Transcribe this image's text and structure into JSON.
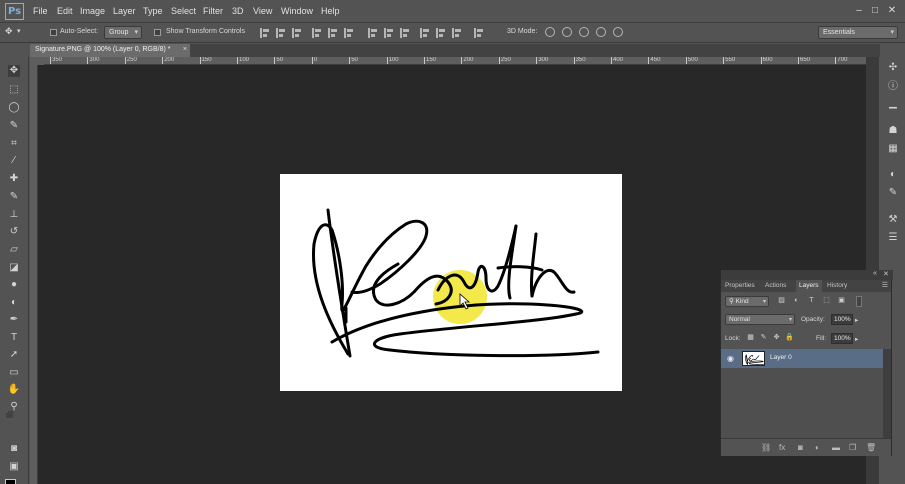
{
  "app": {
    "logo": "Ps",
    "menus": [
      "File",
      "Edit",
      "Image",
      "Layer",
      "Type",
      "Select",
      "Filter",
      "3D",
      "View",
      "Window",
      "Help"
    ],
    "window_controls": [
      "minimize-icon",
      "maximize-icon",
      "close-icon"
    ]
  },
  "options_bar": {
    "auto_select_label": "Auto-Select:",
    "auto_select_mode": "Group",
    "show_transform_label": "Show Transform Controls",
    "mode_3d_label": "3D Mode:",
    "workspace": "Essentials"
  },
  "document": {
    "tab_title": "Signature.PNG @ 100% (Layer 0, RGB/8) *",
    "close_glyph": "×"
  },
  "ruler": {
    "labels": [
      "350",
      "300",
      "250",
      "200",
      "150",
      "100",
      "50",
      "0",
      "50",
      "100",
      "150",
      "200",
      "250",
      "300",
      "350",
      "400",
      "450",
      "500",
      "550",
      "600",
      "650",
      "700"
    ]
  },
  "panel": {
    "tabs": [
      "Properties",
      "Actions",
      "Layers",
      "History"
    ],
    "active_tab": "Layers",
    "filter_kind": "Kind",
    "blend_mode": "Normal",
    "opacity_label": "Opacity:",
    "opacity_value": "100%",
    "lock_label": "Lock:",
    "fill_label": "Fill:",
    "fill_value": "100%",
    "layers": [
      {
        "name": "Layer 0",
        "visible": true,
        "selected": true
      }
    ]
  },
  "colors": {
    "foreground": "#000000",
    "background": "#ffffff",
    "highlight": "#f2e52a",
    "selected_layer": "#5a6d86"
  }
}
